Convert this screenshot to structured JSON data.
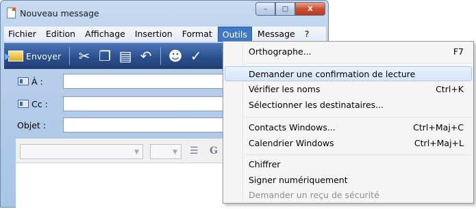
{
  "window": {
    "title": "Nouveau message",
    "controls": {
      "minimize": "–",
      "maximize": "□",
      "close": "X"
    }
  },
  "menubar": {
    "items": [
      "Fichier",
      "Edition",
      "Affichage",
      "Insertion",
      "Format",
      "Outils",
      "Message",
      "?"
    ],
    "active": "Outils"
  },
  "toolbar": {
    "send_label": "Envoyer",
    "icons": [
      "send-icon",
      "cut-icon",
      "copy-icon",
      "paste-icon",
      "undo-icon",
      "check-names-icon",
      "spelling-icon"
    ]
  },
  "fields": {
    "to_label": "À :",
    "cc_label": "Cc :",
    "subject_label": "Objet :",
    "to_value": "",
    "cc_value": "",
    "subject_value": ""
  },
  "format_toolbar": {
    "font_value": "",
    "size_value": "",
    "bold_label": "G"
  },
  "dropdown": {
    "items": [
      {
        "label": "Orthographe...",
        "shortcut": "F7",
        "state": "normal"
      },
      {
        "label": "Demander une confirmation de lecture",
        "shortcut": "",
        "state": "hover"
      },
      {
        "label": "Vérifier les noms",
        "shortcut": "Ctrl+K",
        "state": "normal"
      },
      {
        "label": "Sélectionner les destinataires...",
        "shortcut": "",
        "state": "normal"
      },
      {
        "label": "Contacts Windows...",
        "shortcut": "Ctrl+Maj+C",
        "state": "normal"
      },
      {
        "label": "Calendrier Windows",
        "shortcut": "Ctrl+Maj+L",
        "state": "normal"
      },
      {
        "label": "Chiffrer",
        "shortcut": "",
        "state": "normal"
      },
      {
        "label": "Signer numériquement",
        "shortcut": "",
        "state": "normal"
      },
      {
        "label": "Demander un reçu de sécurité",
        "shortcut": "",
        "state": "disabled"
      }
    ]
  },
  "colors": {
    "menu_active": "#3f78c7",
    "toolbar_bg": "#2a4f8e",
    "hover_bg": "#d6e6fb",
    "disabled_text": "#8d8d8d"
  }
}
